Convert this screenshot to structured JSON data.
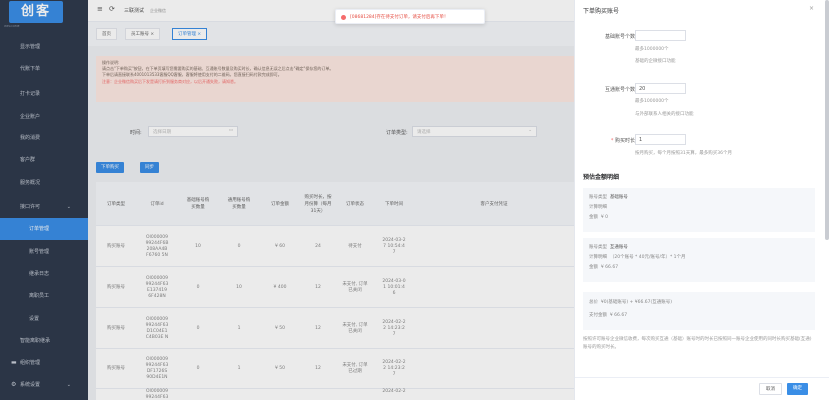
{
  "sidebar": {
    "logo": "创客",
    "logo_sub": "WELCOME",
    "items": [
      {
        "label": "显示管理"
      },
      {
        "label": "代账下单"
      },
      {
        "label": "打卡记录"
      },
      {
        "label": "企业账户"
      },
      {
        "label": "我的消费"
      },
      {
        "label": "客户群"
      },
      {
        "label": "服务概况"
      },
      {
        "label": "接口许可"
      },
      {
        "label": "订单管理"
      },
      {
        "label": "账号管理"
      },
      {
        "label": "继承日志"
      },
      {
        "label": "离职员工"
      },
      {
        "label": "设置"
      },
      {
        "label": "智能离职继承"
      },
      {
        "label": "组织管理"
      },
      {
        "label": "系统设置"
      }
    ]
  },
  "topbar": {
    "menu_icon": "≡",
    "refresh_icon": "⟳",
    "title": "三联测试",
    "subtitle": "企业微信"
  },
  "tabs": [
    {
      "label": "首页"
    },
    {
      "label": "员工账号 ×"
    },
    {
      "label": "订单管理 ×"
    }
  ],
  "notice": {
    "line1": "操作说明:",
    "line2": "请点击\"下单购买\"按钮，在下单页填写您需要购买的基础、互通账号数量及购买时长，确认信息无误之后点击\"确定\"保存您的订单。",
    "line3": "下单后请直接联系4001013533客服QQ客服，客服将使用支付的二维码，您直接扫码付款完成即可。",
    "line4": "注意：企业微信购买后下发是请打折到服务商对应，以后开通失败，请知悉。"
  },
  "filter": {
    "time_label": "时间:",
    "time_placeholder": "选择日期",
    "type_label": "订单类型:",
    "type_placeholder": "请选择",
    "buy_button": "下单购买",
    "sync_button": "同步"
  },
  "table": {
    "headers": [
      "订单类型",
      "订单id",
      "基础账号购买数量",
      "通用账号购买数量",
      "订单金额",
      "购买时长，按月份算（每月31天）",
      "订单状态",
      "下单时间",
      "客户支付凭证"
    ],
    "rows": [
      {
        "type": "购买账号",
        "id": "OI000009 99244F6B 208AA4B F6760 5N",
        "base": "10",
        "general": "0",
        "amount": "¥ 60",
        "duration": "24",
        "status": "待支付",
        "time": "2024-03-2 7 10:54:4 7"
      },
      {
        "type": "购买账号",
        "id": "OI000009 99244F63 E137419 6F428N",
        "base": "0",
        "general": "10",
        "amount": "¥ 400",
        "duration": "12",
        "status": "未支付, 订单已关闭",
        "time": "2024-03-0 1 10:01:4 6"
      },
      {
        "type": "购买账号",
        "id": "OI000009 99244F63 D1C04E1 C4B03E N",
        "base": "0",
        "general": "1",
        "amount": "¥ 50",
        "duration": "12",
        "status": "未支付, 订单已关闭",
        "time": "2024-02-2 2 14:23:2 7"
      },
      {
        "type": "购买账号",
        "id": "OI000009 99244F63 DF1726S 90D4E1N",
        "base": "0",
        "general": "1",
        "amount": "¥ 50",
        "duration": "12",
        "status": "未支付, 订单已过期",
        "time": "2024-02-2 2 14:23:2 7"
      },
      {
        "type": "",
        "id": "OI000009 99244F63",
        "base": "",
        "general": "",
        "amount": "",
        "duration": "",
        "status": "",
        "time": "2024-02-2"
      }
    ]
  },
  "toast": {
    "text": "[08681284]存在待支付订单，请支付后再下单！"
  },
  "drawer": {
    "title": "下单购买账号",
    "close_icon": "×",
    "base_label": "基础账号个数",
    "base_value": "",
    "base_hint1": "最多1000000个",
    "base_hint2": "基础的企微接口功能",
    "inter_label": "互通账号个数",
    "inter_value": "20",
    "inter_hint1": "最多1000000个",
    "inter_hint2": "与外部联系人相关的接口功能",
    "duration_label": "购买时长",
    "duration_value": "1",
    "duration_hint": "按月购买，每个月按照31天算，最多购买36个月",
    "estimate_title": "预估金额明细",
    "card1": {
      "type_label": "账号类型",
      "type_value": "基础账号",
      "detail_label": "计算明细",
      "amount_label": "金额",
      "amount_value": "¥ 0"
    },
    "card2": {
      "type_label": "账号类型",
      "type_value": "互通账号",
      "detail_label": "计算明细",
      "detail_value": "（20个账号 * 40元/账号/年）* 1个月",
      "amount_label": "金额",
      "amount_value": "¥ 66.67"
    },
    "card3": {
      "total_label": "总价",
      "total_value": "¥0(基础账号) + ¥66.67(互通账号)",
      "pay_label": "支付金额",
      "pay_value": "¥ 66.67"
    },
    "note": "按照许可账号企业微信收费，每次购买互通（基础）账号时的时长已按照同一账号企业使用的同时长购买基础(互通)账号的购买时长。",
    "cancel": "取消",
    "confirm": "确定"
  }
}
